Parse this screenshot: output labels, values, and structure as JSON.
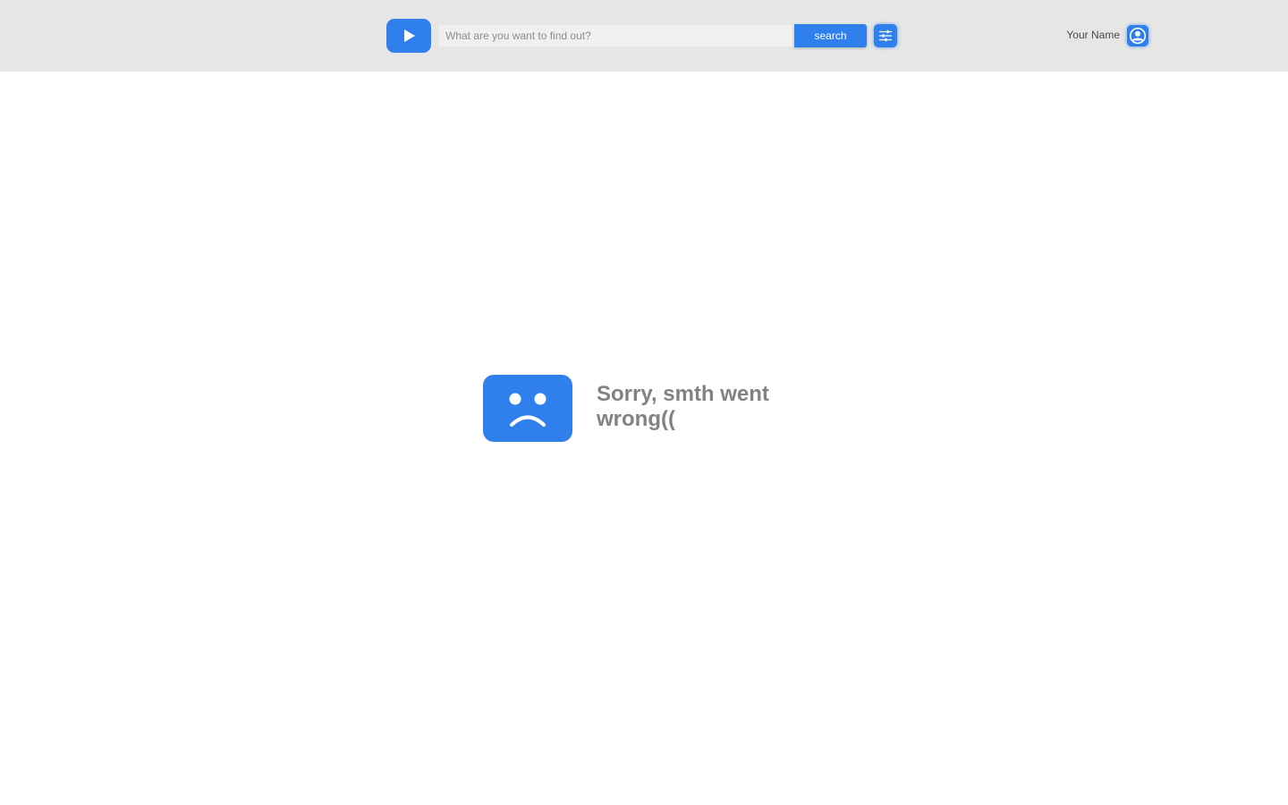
{
  "header": {
    "logo_icon": "play-icon",
    "search": {
      "placeholder": "What are you want to find out?",
      "value": ""
    },
    "search_button_label": "search",
    "filter_icon": "sliders-icon",
    "user": {
      "name": "Your Name",
      "avatar_icon": "user-circle-icon"
    }
  },
  "error": {
    "icon": "sad-face-icon",
    "message": "Sorry, smth went wrong(("
  },
  "colors": {
    "accent": "#2f80ed",
    "header_bg": "#e6e6e6",
    "message_text": "#828282"
  }
}
